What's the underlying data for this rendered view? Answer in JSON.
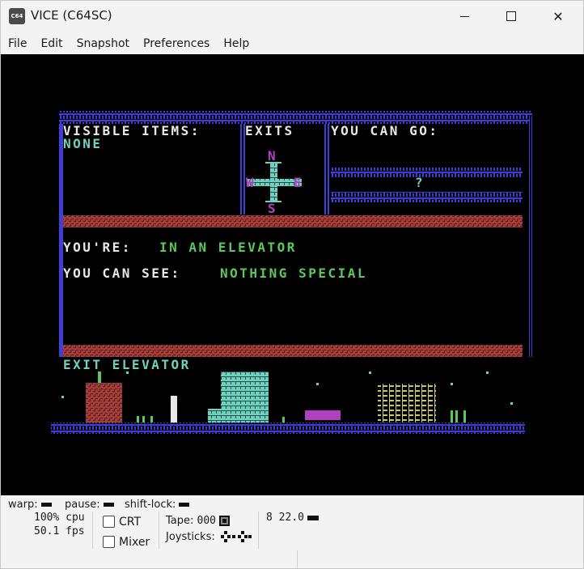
{
  "window": {
    "title": "VICE (C64SC)",
    "icon_label": "C64"
  },
  "menu": [
    "File",
    "Edit",
    "Snapshot",
    "Preferences",
    "Help"
  ],
  "game": {
    "visible_items_label": "VISIBLE ITEMS:",
    "visible_items_value": "NONE",
    "exits_label": "EXITS",
    "you_can_go_label": "YOU CAN GO:",
    "compass": {
      "n": "N",
      "s": "S",
      "e": "E",
      "w": "W"
    },
    "unknown_exit": "?",
    "location_label": "YOU'RE:",
    "location_value": "IN AN ELEVATOR",
    "see_label": "YOU CAN SEE:",
    "see_value": "NOTHING SPECIAL",
    "command": "EXIT ELEVATOR"
  },
  "status": {
    "warp": "warp:",
    "pause": "pause:",
    "shift_lock": "shift-lock:",
    "cpu": "100% cpu",
    "fps": "50.1 fps",
    "crt": "CRT",
    "mixer": "Mixer",
    "tape_label": "Tape:",
    "tape_counter": "000",
    "joysticks_label": "Joysticks:",
    "drive": "8 22.0"
  },
  "colors": {
    "c64_blue": "#3f3fd8",
    "c64_red": "#a23e3a",
    "c64_green": "#5cc85c",
    "c64_cyan": "#70d0c0",
    "c64_purple": "#b040c0",
    "c64_white": "#e8e8e8",
    "c64_yellow": "#c8c868"
  }
}
